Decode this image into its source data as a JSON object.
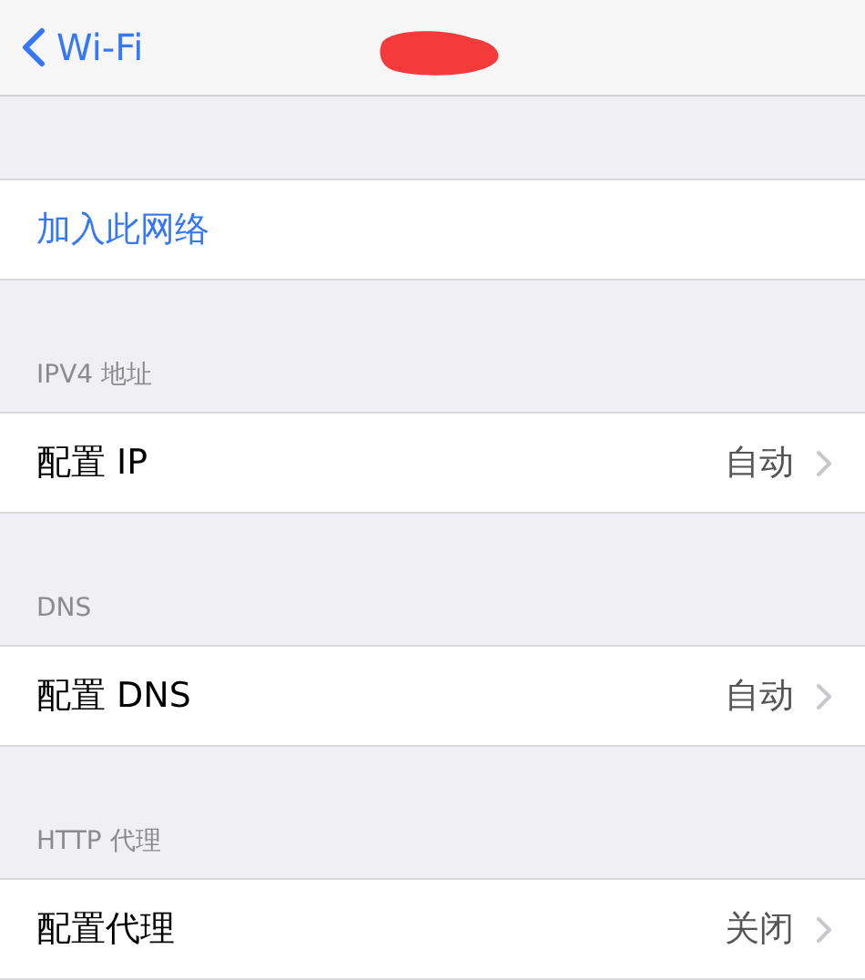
{
  "nav_bar": {
    "back_label": "Wi-Fi"
  },
  "join_network": {
    "label": "加入此网络"
  },
  "sections": [
    {
      "header": "IPV4 地址",
      "row": {
        "label": "配置 IP",
        "value": "自动"
      }
    },
    {
      "header": "DNS",
      "row": {
        "label": "配置 DNS",
        "value": "自动"
      }
    },
    {
      "header": "HTTP 代理",
      "row": {
        "label": "配置代理",
        "value": "关闭"
      }
    }
  ]
}
